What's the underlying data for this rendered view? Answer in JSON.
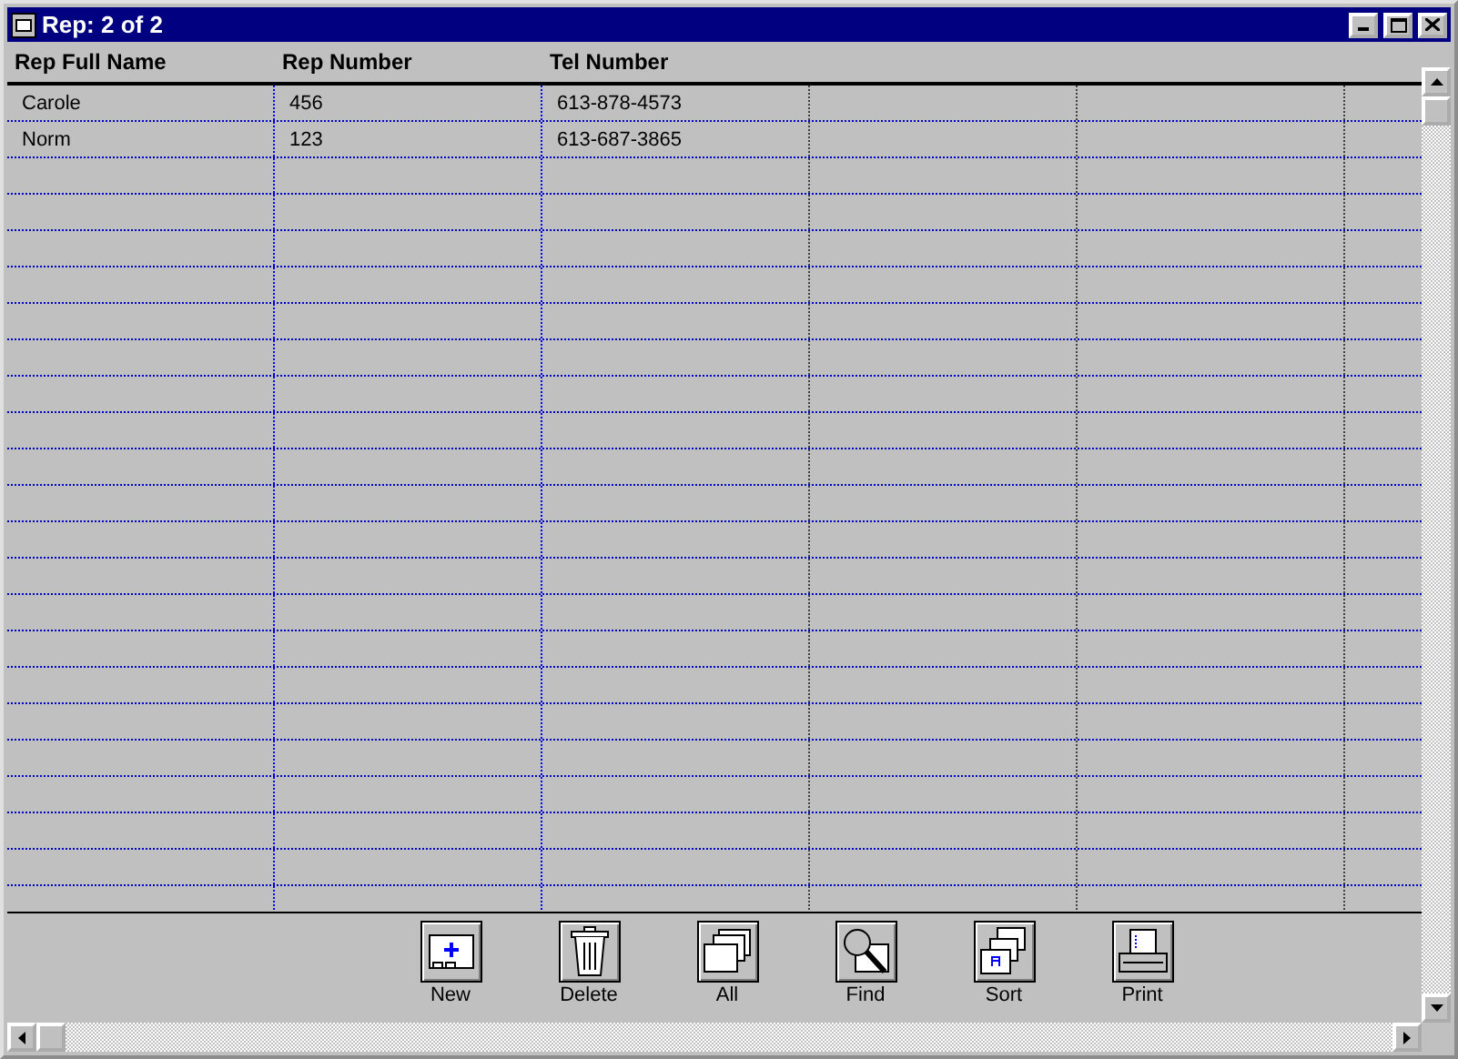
{
  "window": {
    "title": "Rep: 2 of 2"
  },
  "table": {
    "columns": [
      "Rep Full Name",
      "Rep Number",
      "Tel Number"
    ],
    "rows": [
      [
        "Carole",
        "456",
        "613-878-4573"
      ],
      [
        "Norm",
        "123",
        "613-687-3865"
      ]
    ]
  },
  "toolbar": [
    {
      "label": "New",
      "kind": "new"
    },
    {
      "label": "Delete",
      "kind": "delete"
    },
    {
      "label": "All",
      "kind": "all"
    },
    {
      "label": "Find",
      "kind": "find"
    },
    {
      "label": "Sort",
      "kind": "sort"
    },
    {
      "label": "Print",
      "kind": "print"
    }
  ]
}
